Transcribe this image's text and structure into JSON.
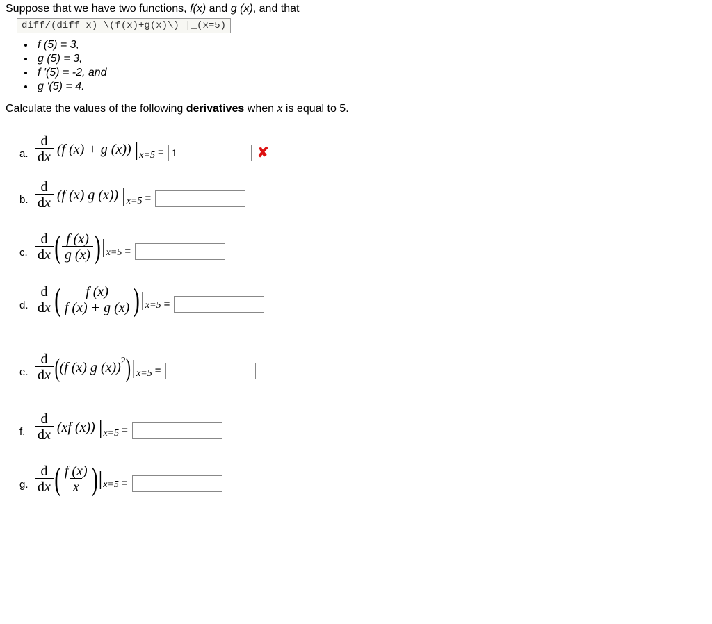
{
  "intro": {
    "text_before": "Suppose that we have two functions, ",
    "f_of_x": "f(x)",
    "mid": " and ",
    "g_of_x": "g (x)",
    "text_after": ", and that"
  },
  "code_line": "diff/(diff x) \\(f(x)+g(x)\\) |_(x=5)",
  "given": [
    "f (5) = 3,",
    "g (5) = 3,",
    "f '(5) = -2, and",
    "g '(5) = 4."
  ],
  "prompt": {
    "before": "Calculate the values of the following ",
    "bold": "derivatives",
    "after": " when ",
    "xvar": "x",
    "tail": " is equal to 5."
  },
  "labels": {
    "a": "a.",
    "b": "b.",
    "c": "c.",
    "d": "d.",
    "e": "e.",
    "f": "f.",
    "g": "g."
  },
  "ddx": {
    "num": "d",
    "den": "dx"
  },
  "exprs": {
    "a": "(f (x) + g (x))",
    "b": "(f (x) g (x))",
    "c_num": "f (x)",
    "c_den": "g (x)",
    "d_num": "f (x)",
    "d_den": "f (x) + g (x)",
    "e_inner": "(f (x) g (x))",
    "e_power": "2",
    "f": "(xf (x))",
    "g_num": "f (x)",
    "g_den": "x"
  },
  "eval_at": "x=5",
  "equals": "=",
  "answers": {
    "a": "1",
    "b": "",
    "c": "",
    "d": "",
    "e": "",
    "f": "",
    "g": ""
  },
  "icons": {
    "wrong_alt": "incorrect"
  }
}
